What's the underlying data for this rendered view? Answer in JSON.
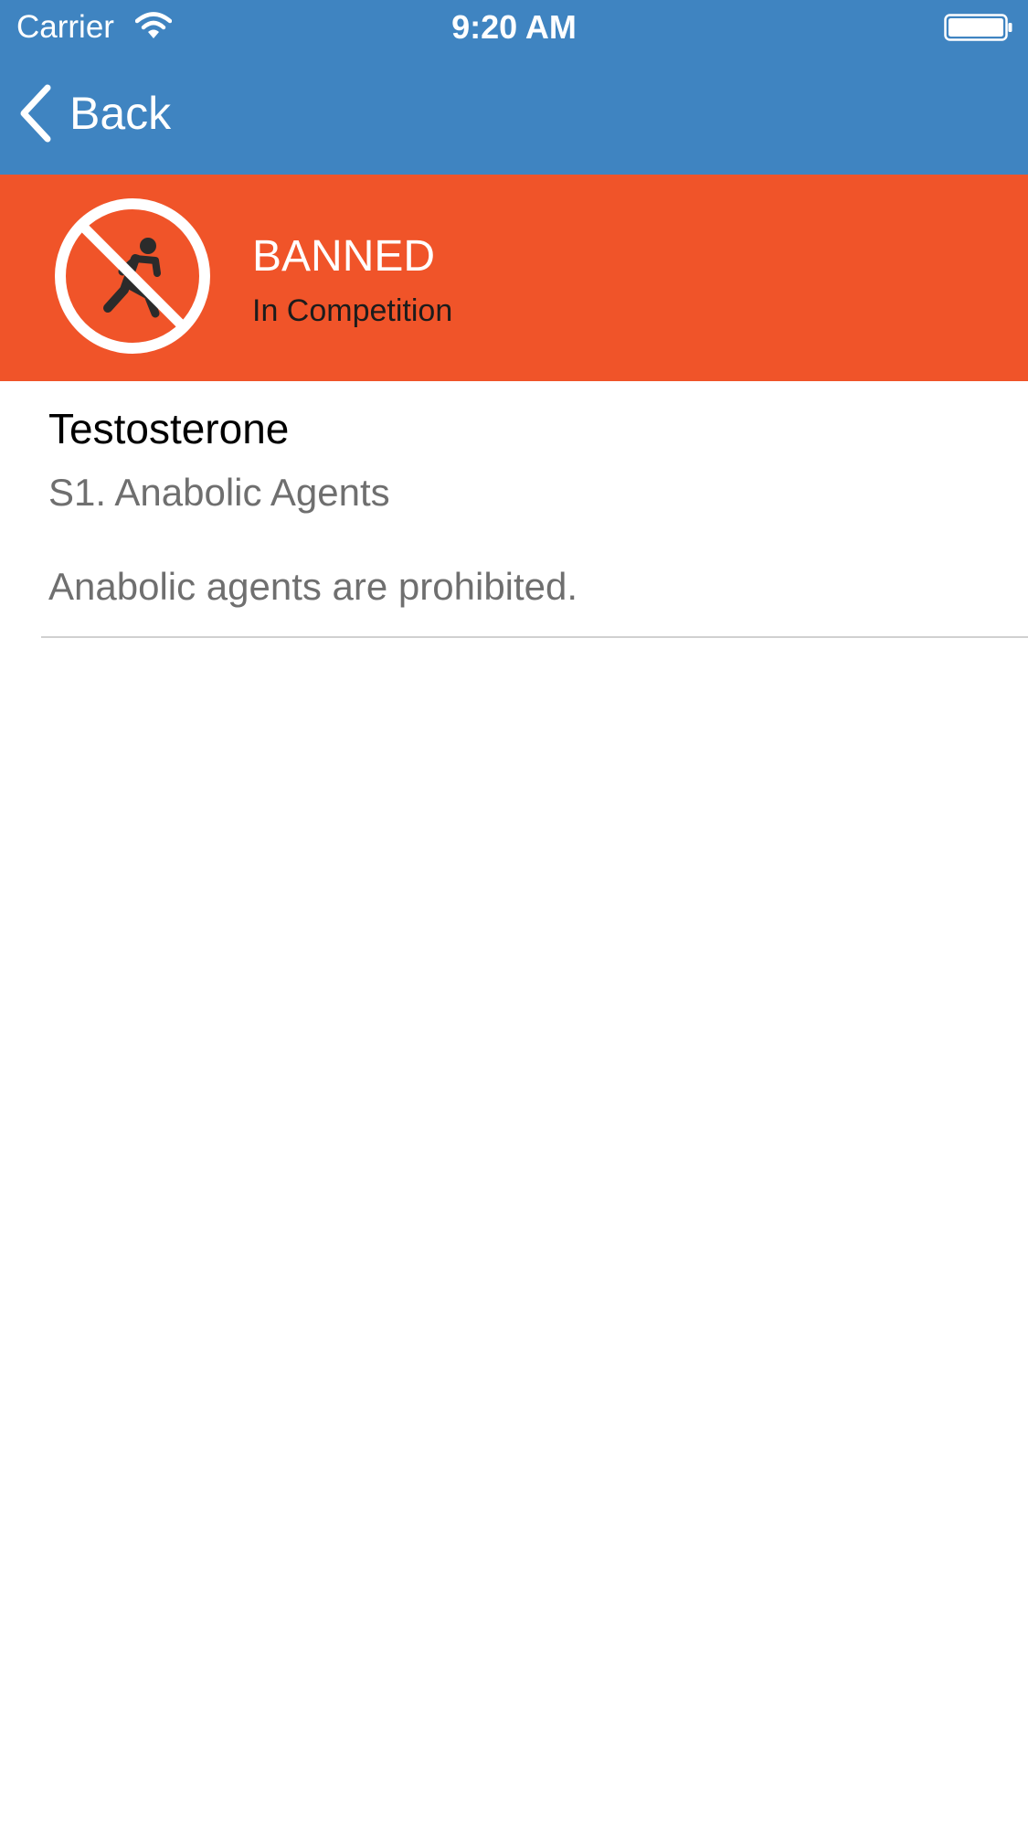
{
  "status_bar": {
    "carrier": "Carrier",
    "time": "9:20 AM",
    "wifi_icon": "wifi-icon",
    "battery_icon": "battery-icon"
  },
  "nav": {
    "back_label": "Back",
    "back_icon": "chevron-left-icon"
  },
  "banner": {
    "status": "BANNED",
    "context": "In Competition",
    "icon": "no-running-icon",
    "background_color": "#f05429"
  },
  "substance": {
    "name": "Testosterone",
    "class": "S1. Anabolic Agents",
    "description": "Anabolic agents are prohibited."
  },
  "colors": {
    "header": "#3f84c1",
    "banner": "#f05429"
  }
}
